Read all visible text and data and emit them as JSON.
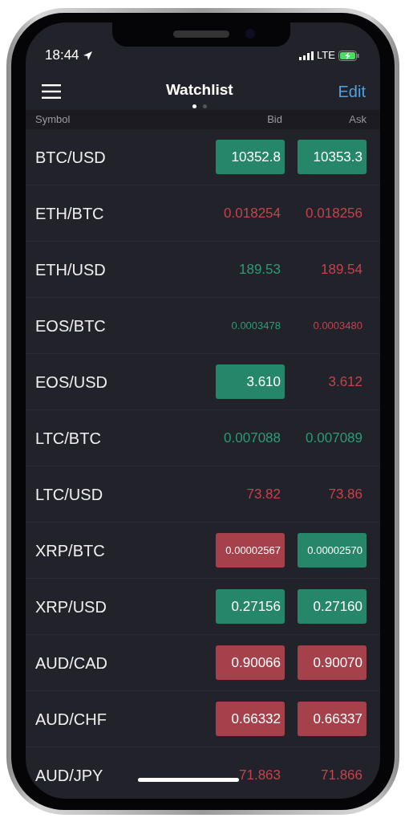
{
  "status_bar": {
    "time": "18:44",
    "network": "LTE"
  },
  "header": {
    "title": "Watchlist",
    "action": "Edit",
    "pages": [
      {
        "selected": true
      },
      {
        "selected": false
      }
    ]
  },
  "columns": [
    "Symbol",
    "Bid",
    "Ask"
  ],
  "rows": [
    {
      "symbol": "BTC/USD",
      "bid": {
        "text": "10352.8",
        "rising": true,
        "highlighted": true
      },
      "ask": {
        "text": "10353.3",
        "rising": true,
        "highlighted": true
      }
    },
    {
      "symbol": "ETH/BTC",
      "bid": {
        "text": "0.018254",
        "rising": false,
        "highlighted": false
      },
      "ask": {
        "text": "0.018256",
        "rising": false,
        "highlighted": false
      }
    },
    {
      "symbol": "ETH/USD",
      "bid": {
        "text": "189.53",
        "rising": true,
        "highlighted": false
      },
      "ask": {
        "text": "189.54",
        "rising": false,
        "highlighted": false
      }
    },
    {
      "symbol": "EOS/BTC",
      "bid": {
        "text": "0.0003478",
        "rising": true,
        "highlighted": false
      },
      "ask": {
        "text": "0.0003480",
        "rising": false,
        "highlighted": false
      }
    },
    {
      "symbol": "EOS/USD",
      "bid": {
        "text": "3.610",
        "rising": true,
        "highlighted": true
      },
      "ask": {
        "text": "3.612",
        "rising": false,
        "highlighted": false
      }
    },
    {
      "symbol": "LTC/BTC",
      "bid": {
        "text": "0.007088",
        "rising": true,
        "highlighted": false
      },
      "ask": {
        "text": "0.007089",
        "rising": true,
        "highlighted": false
      }
    },
    {
      "symbol": "LTC/USD",
      "bid": {
        "text": "73.82",
        "rising": false,
        "highlighted": false
      },
      "ask": {
        "text": "73.86",
        "rising": false,
        "highlighted": false
      }
    },
    {
      "symbol": "XRP/BTC",
      "bid": {
        "text": "0.00002567",
        "rising": false,
        "highlighted": true
      },
      "ask": {
        "text": "0.00002570",
        "rising": true,
        "highlighted": true
      }
    },
    {
      "symbol": "XRP/USD",
      "bid": {
        "text": "0.27156",
        "rising": true,
        "highlighted": true
      },
      "ask": {
        "text": "0.27160",
        "rising": true,
        "highlighted": true
      }
    },
    {
      "symbol": "AUD/CAD",
      "bid": {
        "text": "0.90066",
        "rising": false,
        "highlighted": true
      },
      "ask": {
        "text": "0.90070",
        "rising": false,
        "highlighted": true
      }
    },
    {
      "symbol": "AUD/CHF",
      "bid": {
        "text": "0.66332",
        "rising": false,
        "highlighted": true
      },
      "ask": {
        "text": "0.66337",
        "rising": false,
        "highlighted": true
      }
    },
    {
      "symbol": "AUD/JPY",
      "bid": {
        "text": "71.863",
        "rising": false,
        "highlighted": false
      },
      "ask": {
        "text": "71.866",
        "rising": false,
        "highlighted": false
      }
    }
  ]
}
